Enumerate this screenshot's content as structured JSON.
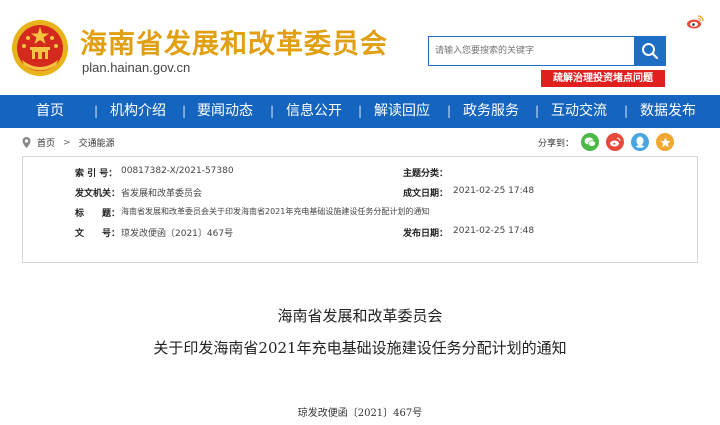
{
  "header": {
    "site_title": "海南省发展和改革委员会",
    "site_url": "plan.hainan.gov.cn",
    "search_placeholder": "请输入您要搜索的关键字",
    "promo_label": "疏解治理投资堵点问题"
  },
  "nav": {
    "items": [
      {
        "label": "首页"
      },
      {
        "label": "机构介绍"
      },
      {
        "label": "要闻动态"
      },
      {
        "label": "信息公开"
      },
      {
        "label": "解读回应"
      },
      {
        "label": "政务服务"
      },
      {
        "label": "互动交流"
      },
      {
        "label": "数据发布"
      }
    ]
  },
  "breadcrumb": {
    "home": "首页",
    "separator": ">",
    "current": "交通能源"
  },
  "share": {
    "label": "分享到："
  },
  "info": {
    "index_label": "索 引 号：",
    "index_value": "00817382-X/2021-57380",
    "topic_label": "主题分类：",
    "topic_value": "",
    "issuer_label": "发文机关：",
    "issuer_value": "省发展和改革委员会",
    "created_label": "成文日期：",
    "created_value": "2021-02-25 17:48",
    "title_label": "标　　题：",
    "title_value": "海南省发展和改革委员会关于印发海南省2021年充电基础设施建设任务分配计划的通知",
    "docno_label": "文　　号：",
    "docno_value": "琼发改便函〔2021〕467号",
    "published_label": "发布日期：",
    "published_value": "2021-02-25 17:48"
  },
  "document": {
    "issuer": "海南省发展和改革委员会",
    "title": "关于印发海南省2021年充电基础设施建设任务分配计划的通知",
    "number": "琼发改便函〔2021〕467号"
  },
  "colors": {
    "nav_bg": "#1565c0",
    "title_gold": "#e0a011",
    "promo_red": "#e01f1f",
    "share_wechat": "#4cb848",
    "share_weibo": "#e6493b",
    "share_qq": "#4aa5e0",
    "share_star": "#f2a830"
  }
}
